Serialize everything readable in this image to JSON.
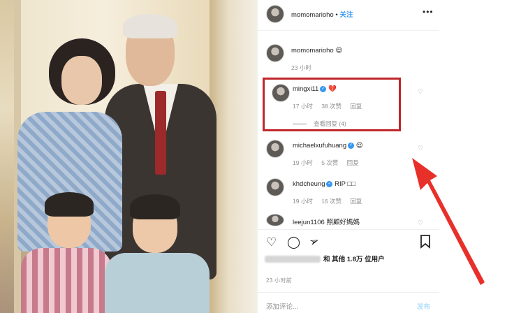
{
  "post": {
    "author": "momomarioho",
    "dot": "•",
    "follow_label": "关注",
    "more_label": "•••"
  },
  "comments": [
    {
      "username": "momomarioho",
      "text": "😌",
      "time": "23 小时",
      "likes": "",
      "reply": ""
    },
    {
      "username": "mingxi11",
      "text": "💔",
      "time": "17 小时",
      "likes": "38 次赞",
      "reply": "回复",
      "view_replies": "查看回复 (4)"
    },
    {
      "username": "michaelxufuhuang",
      "text": "😌",
      "time": "19 小时",
      "likes": "5 次赞",
      "reply": "回复"
    },
    {
      "username": "khdcheung",
      "text": "RIP □□",
      "time": "19 小时",
      "likes": "16 次赞",
      "reply": "回复"
    },
    {
      "username": "leejun1106",
      "text": "照顧好媽媽",
      "time": "",
      "likes": "",
      "reply": ""
    }
  ],
  "likes_text": "和 其他 1.8万 位用户",
  "posted_time": "23 小时前",
  "comment_placeholder": "添加评论...",
  "publish_label": "发布",
  "colors": {
    "accent": "#3897f0",
    "highlight": "#c0262b",
    "arrow": "#e8302a"
  },
  "icons": [
    "heart-icon",
    "comment-icon",
    "share-icon",
    "bookmark-icon",
    "verified-icon",
    "more-icon"
  ]
}
